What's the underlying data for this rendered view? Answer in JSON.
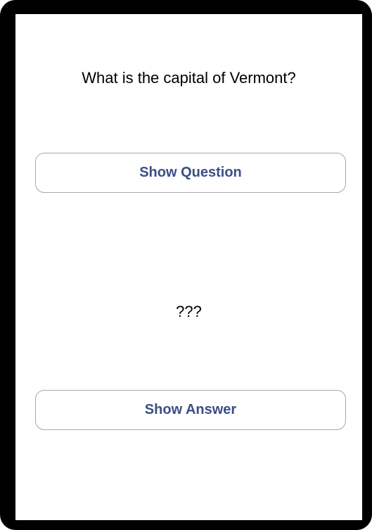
{
  "question": {
    "text": "What is the capital of Vermont?"
  },
  "buttons": {
    "show_question_label": "Show Question",
    "show_answer_label": "Show Answer"
  },
  "answer": {
    "text": "???"
  },
  "colors": {
    "button_text": "#3b4f86",
    "button_border": "#a9a9a9",
    "frame": "#000000",
    "screen_background": "#ffffff"
  }
}
